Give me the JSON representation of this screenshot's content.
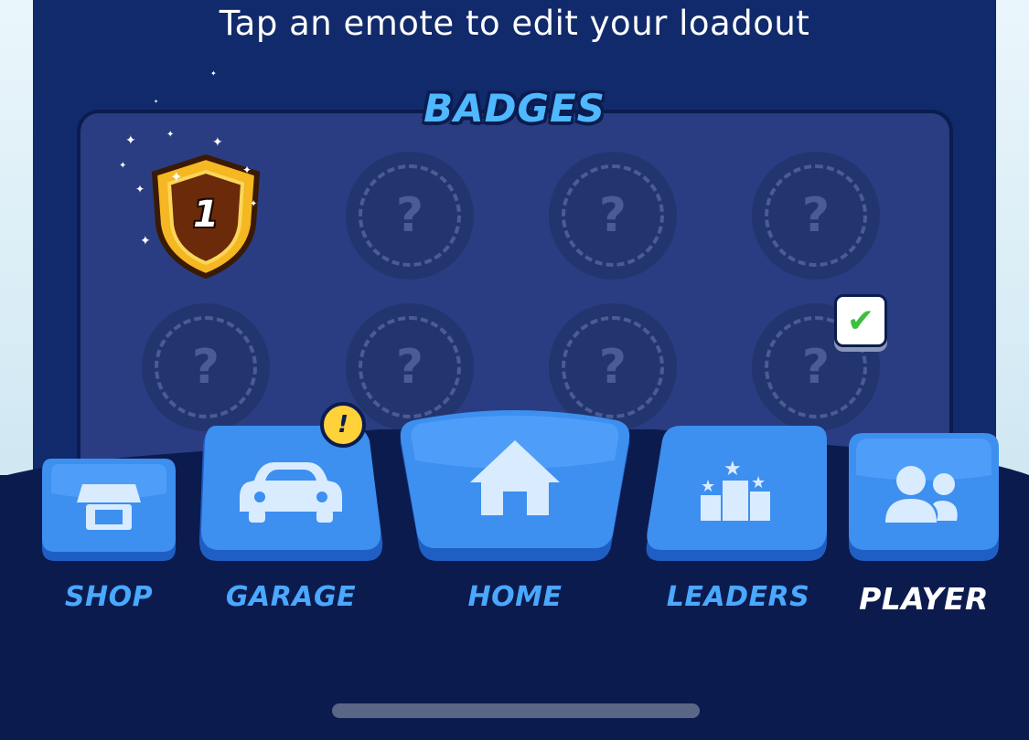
{
  "header": {
    "instruction": "Tap an emote to edit your loadout"
  },
  "badges": {
    "title": "BADGES",
    "earned": [
      {
        "number": "1"
      }
    ],
    "empty_symbol": "?",
    "selected_mark": "✔"
  },
  "nav": {
    "items": [
      {
        "label": "SHOP",
        "icon": "shop-icon"
      },
      {
        "label": "GARAGE",
        "icon": "car-icon",
        "alert": "!"
      },
      {
        "label": "HOME",
        "icon": "home-icon"
      },
      {
        "label": "LEADERS",
        "icon": "leaders-icon"
      },
      {
        "label": "PLAYER",
        "icon": "player-icon",
        "active": true
      }
    ]
  },
  "colors": {
    "panel": "#112a6b",
    "button": "#3d8ff0",
    "label": "#4aa8ff",
    "active_label": "#ffffff"
  }
}
